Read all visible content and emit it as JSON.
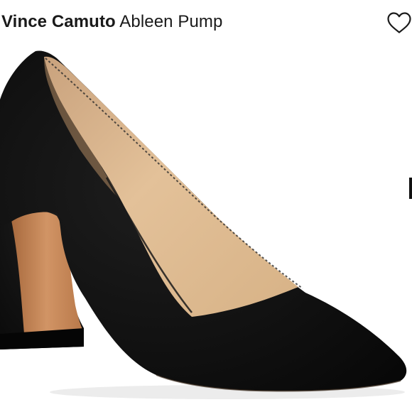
{
  "product": {
    "brand": "Vince Camuto",
    "name": "Ableen Pump"
  },
  "icons": {
    "favorite": "heart-outline-icon"
  },
  "colors": {
    "text": "#1a1a1a",
    "shoe_upper": "#0f0f0f",
    "heel_inner": "#c98a5a",
    "lining": "#dcb88e"
  }
}
